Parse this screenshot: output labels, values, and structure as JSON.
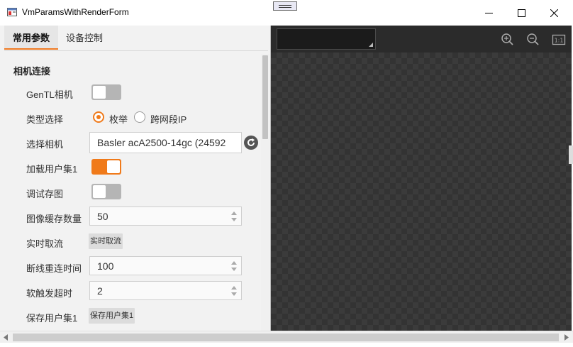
{
  "window": {
    "title": "VmParamsWithRenderForm",
    "minimize_icon": "minimize-icon",
    "maximize_icon": "maximize-icon",
    "close_icon": "close-icon"
  },
  "tabs": [
    {
      "label": "常用参数",
      "active": true
    },
    {
      "label": "设备控制",
      "active": false
    }
  ],
  "section": {
    "title": "相机连接"
  },
  "params": {
    "gentl": {
      "label": "GenTL相机",
      "on": false
    },
    "type_select": {
      "label": "类型选择",
      "options": [
        "枚举",
        "跨网段IP"
      ],
      "selected": "枚举"
    },
    "camera": {
      "label": "选择相机",
      "value": "Basler acA2500-14gc (24592"
    },
    "load_userset": {
      "label": "加载用户集1",
      "on": true
    },
    "debug_save": {
      "label": "调试存图",
      "on": false
    },
    "image_cache": {
      "label": "图像缓存数量",
      "value": "50"
    },
    "realtime": {
      "label": "实时取流",
      "button": "实时取流"
    },
    "reconnect": {
      "label": "断线重连时间",
      "value": "100"
    },
    "soft_trigger": {
      "label": "软触发超时",
      "value": "2"
    },
    "save_userset": {
      "label": "保存用户集1",
      "button": "保存用户集1"
    }
  },
  "render_toolbar": {
    "zoom_in_icon": "zoom-in-icon",
    "zoom_out_icon": "zoom-out-icon",
    "actual_size_label": "1:1"
  },
  "colors": {
    "accent": "#f07a1a",
    "canvas": "#333333"
  }
}
